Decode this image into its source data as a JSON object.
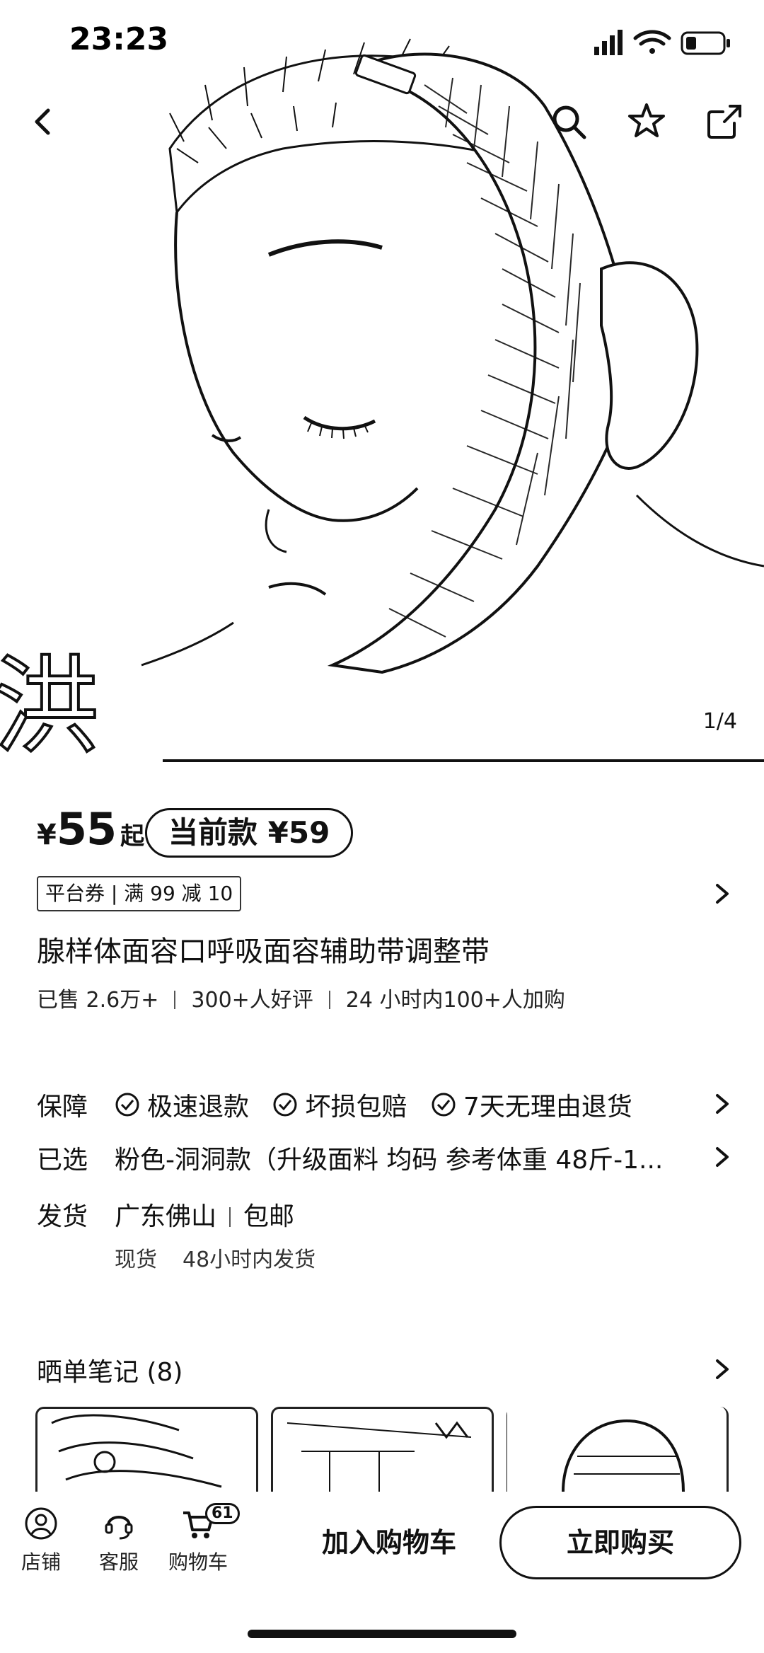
{
  "status_bar": {
    "time": "23:23"
  },
  "hero": {
    "counter": "1/4",
    "watermark": "洪"
  },
  "price": {
    "currency": "¥",
    "amount": "55",
    "suffix": "起",
    "current_label": "当前款 ¥59"
  },
  "coupon": {
    "label": "平台券 | 满 99 减 10"
  },
  "product": {
    "title": "腺样体面容口呼吸面容辅助带调整带",
    "stats": [
      "已售 2.6万+",
      "300+人好评",
      "24 小时内100+人加购"
    ]
  },
  "guarantee": {
    "label": "保障",
    "items": [
      "极速退款",
      "坏损包赔",
      "7天无理由退货"
    ]
  },
  "selected": {
    "label": "已选",
    "value": "粉色-洞洞款（升级面料 均码 参考体重 48斤-1..."
  },
  "shipping": {
    "label": "发货",
    "origin": "广东佛山",
    "free": "包邮",
    "stock": "现货",
    "time": "48小时内发货"
  },
  "notes": {
    "title": "晒单笔记 (8)"
  },
  "bottom_bar": {
    "store": "店铺",
    "service": "客服",
    "cart": "购物车",
    "cart_badge": "61",
    "add_to_cart": "加入购物车",
    "buy_now": "立即购买"
  },
  "icons": [
    "back-icon",
    "search-icon",
    "star-icon",
    "share-icon",
    "chevron-right-icon",
    "check-circle-icon",
    "store-icon",
    "headset-icon",
    "cart-icon"
  ]
}
